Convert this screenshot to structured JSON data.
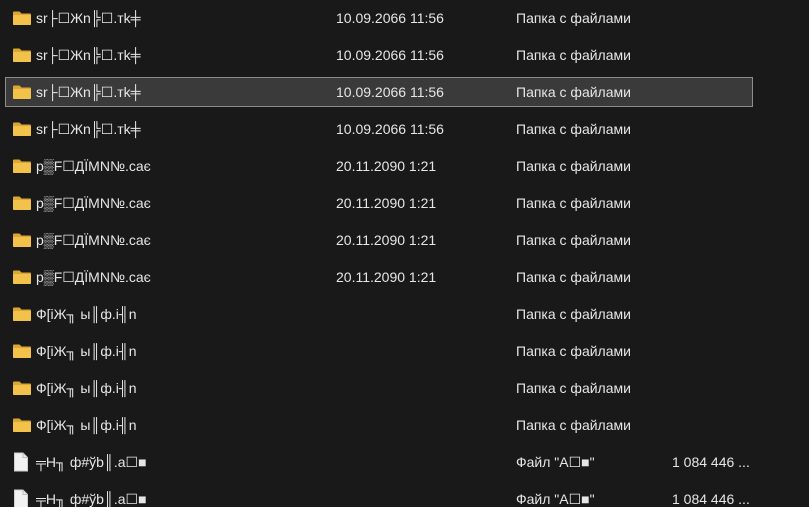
{
  "rows": [
    {
      "kind": "folder",
      "name": "sr├☐Жn╠☐.тk╪",
      "date": "10.09.2066 11:56",
      "type": "Папка с файлами",
      "size": "",
      "selected": false
    },
    {
      "kind": "folder",
      "name": "sr├☐Жn╠☐.тk╪",
      "date": "10.09.2066 11:56",
      "type": "Папка с файлами",
      "size": "",
      "selected": false
    },
    {
      "kind": "folder",
      "name": "sr├☐Жn╠☐.тk╪",
      "date": "10.09.2066 11:56",
      "type": "Папка с файлами",
      "size": "",
      "selected": true
    },
    {
      "kind": "folder",
      "name": "sr├☐Жn╠☐.тk╪",
      "date": "10.09.2066 11:56",
      "type": "Папка с файлами",
      "size": "",
      "selected": false
    },
    {
      "kind": "folder",
      "name": "p▒F☐ДÏMN№.caє",
      "date": "20.11.2090 1:21",
      "type": "Папка с файлами",
      "size": "",
      "selected": false
    },
    {
      "kind": "folder",
      "name": "p▒F☐ДÏMN№.caє",
      "date": "20.11.2090 1:21",
      "type": "Папка с файлами",
      "size": "",
      "selected": false
    },
    {
      "kind": "folder",
      "name": "p▒F☐ДÏMN№.caє",
      "date": "20.11.2090 1:21",
      "type": "Папка с файлами",
      "size": "",
      "selected": false
    },
    {
      "kind": "folder",
      "name": "p▒F☐ДÏMN№.caє",
      "date": "20.11.2090 1:21",
      "type": "Папка с файлами",
      "size": "",
      "selected": false
    },
    {
      "kind": "folder",
      "name": "Ф[iЖ╖ ы║ф.i╢n",
      "date": "",
      "type": "Папка с файлами",
      "size": "",
      "selected": false
    },
    {
      "kind": "folder",
      "name": "Ф[iЖ╖ ы║ф.i╢n",
      "date": "",
      "type": "Папка с файлами",
      "size": "",
      "selected": false
    },
    {
      "kind": "folder",
      "name": "Ф[iЖ╖ ы║ф.i╢n",
      "date": "",
      "type": "Папка с файлами",
      "size": "",
      "selected": false
    },
    {
      "kind": "folder",
      "name": "Ф[iЖ╖ ы║ф.i╢n",
      "date": "",
      "type": "Папка с файлами",
      "size": "",
      "selected": false
    },
    {
      "kind": "file",
      "name": "╤H╖ ф#ўb║.a☐■",
      "date": "",
      "type": "Файл \"A☐■\"",
      "size": "1 084 446 ...",
      "selected": false
    },
    {
      "kind": "file",
      "name": "╤H╖ ф#ўb║.a☐■",
      "date": "",
      "type": "Файл \"A☐■\"",
      "size": "1 084 446 ...",
      "selected": false
    }
  ],
  "colors": {
    "background": "#191919",
    "text": "#e6e6e6",
    "selected_bg": "#3a3a3a",
    "selected_border": "#8d8d8d",
    "folder": "#f3c24a",
    "folder_dark": "#dca635",
    "file": "#f2f2f2"
  },
  "icons": {
    "folder": "folder-icon",
    "file": "file-icon"
  }
}
